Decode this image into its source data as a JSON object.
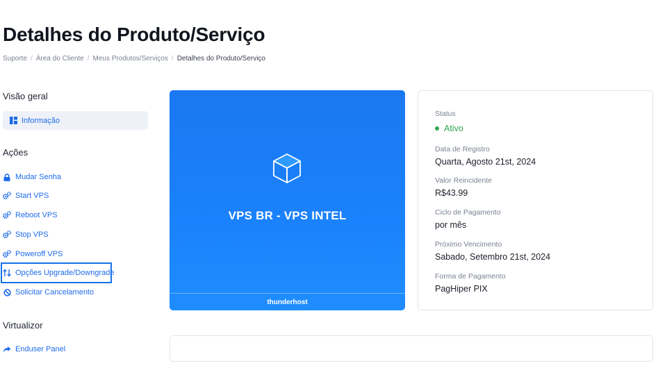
{
  "page": {
    "title": "Detalhes do Produto/Serviço"
  },
  "breadcrumb": {
    "items": [
      "Suporte",
      "Área do Cliente",
      "Meus Produtos/Serviços"
    ],
    "current": "Detalhes do Produto/Serviço",
    "separator": "/"
  },
  "sidebar": {
    "overview_title": "Visão geral",
    "overview_item": {
      "label": "Informação",
      "icon": "dashboard-icon"
    },
    "actions_title": "Ações",
    "actions": [
      {
        "label": "Mudar Senha",
        "icon": "lock-icon"
      },
      {
        "label": "Start VPS",
        "icon": "cogs-icon"
      },
      {
        "label": "Reboot VPS",
        "icon": "cogs-icon"
      },
      {
        "label": "Stop VPS",
        "icon": "cogs-icon"
      },
      {
        "label": "Poweroff VPS",
        "icon": "cogs-icon"
      },
      {
        "label": "Opções Upgrade/Downgrade",
        "icon": "sort-arrows-icon"
      },
      {
        "label": "Solicitar Cancelamento",
        "icon": "ban-icon"
      }
    ],
    "virtualizor_title": "Virtualizor",
    "virtualizor_items": [
      {
        "label": "Enduser Panel",
        "icon": "share-arrow-icon"
      }
    ]
  },
  "product": {
    "name": "VPS BR - VPS INTEL",
    "footer": "thunderhost",
    "icon": "cube-icon",
    "colors": {
      "gradient_top": "#1a78f2",
      "gradient_bottom": "#1e8dff"
    }
  },
  "info": {
    "status_label": "Status",
    "status_value": "Ativo",
    "status_color": "#2fa84f",
    "registration_label": "Data de Registro",
    "registration_value": "Quarta, Agosto 21st, 2024",
    "recurring_label": "Valor Reincidente",
    "recurring_value": "R$43.99",
    "cycle_label": "Ciclo de Pagamento",
    "cycle_value": "por mês",
    "due_label": "Próximo Vencimento",
    "due_value": "Sabado, Setembro 21st, 2024",
    "payment_label": "Forma de Pagamento",
    "payment_value": "PagHiper PIX"
  },
  "theme": {
    "accent": "#1f6bea",
    "highlight_border": "#1570e8"
  }
}
